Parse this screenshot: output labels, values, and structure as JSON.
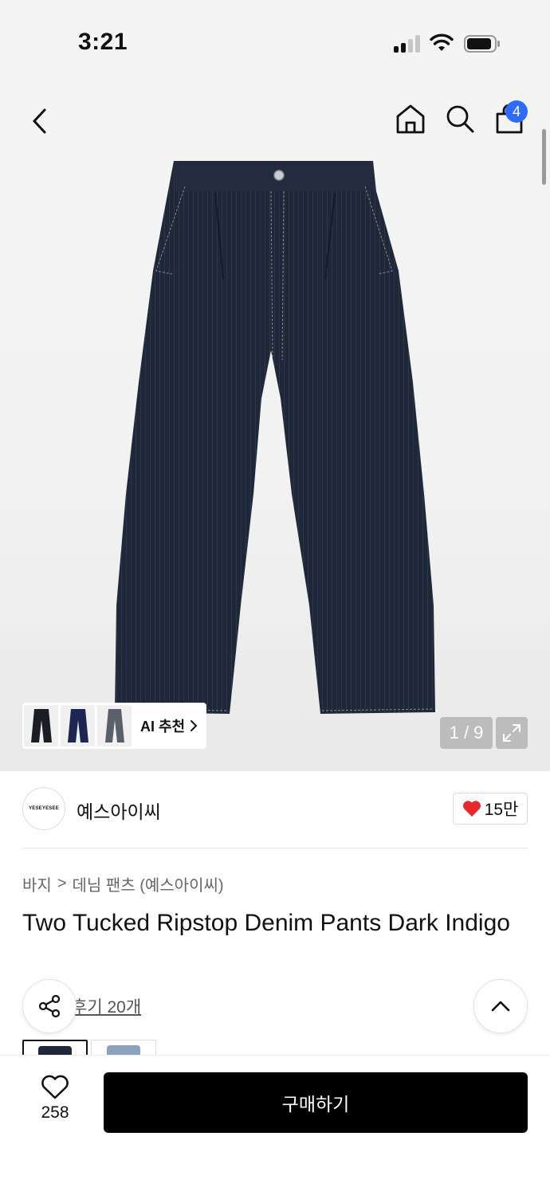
{
  "status": {
    "time": "3:21"
  },
  "header": {
    "cart_count": "4"
  },
  "gallery": {
    "page_indicator": "1 / 9",
    "current_page": 1,
    "total_pages": 9
  },
  "ai_rec": {
    "label": "AI 추천"
  },
  "brand": {
    "logo_text": "YESEYESEE",
    "name": "예스아이씨",
    "likes": "15만"
  },
  "breadcrumb": {
    "category": "바지",
    "separator": ">",
    "subcategory": "데님 팬츠 (예스아이씨)"
  },
  "product": {
    "title": "Two Tucked Ripstop Denim Pants Dark Indigo",
    "reviews_link": "후기 20개"
  },
  "bottom": {
    "wish_count": "258",
    "buy_label": "구매하기"
  },
  "colors": {
    "accent_badge": "#2f6cf6",
    "heart": "#e8262e",
    "denim": "#1f2838"
  }
}
